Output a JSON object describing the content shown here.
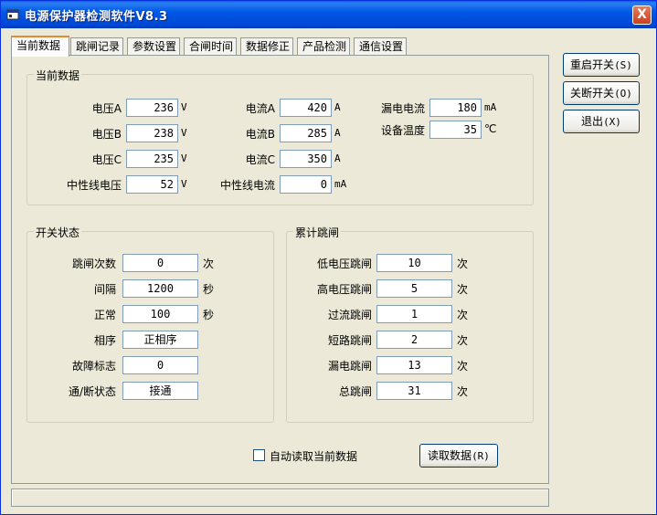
{
  "window": {
    "title": "电源保护器检测软件V8.3",
    "close_label": "X"
  },
  "tabs": [
    "当前数据",
    "跳闸记录",
    "参数设置",
    "合闸时间",
    "数据修正",
    "产品检测",
    "通信设置"
  ],
  "current": {
    "group_title": "当前数据",
    "voltage_a": {
      "label": "电压A",
      "value": "236",
      "unit": "V"
    },
    "voltage_b": {
      "label": "电压B",
      "value": "238",
      "unit": "V"
    },
    "voltage_c": {
      "label": "电压C",
      "value": "235",
      "unit": "V"
    },
    "neutral_voltage": {
      "label": "中性线电压",
      "value": "52",
      "unit": "V"
    },
    "current_a": {
      "label": "电流A",
      "value": "420",
      "unit": "A"
    },
    "current_b": {
      "label": "电流B",
      "value": "285",
      "unit": "A"
    },
    "current_c": {
      "label": "电流C",
      "value": "350",
      "unit": "A"
    },
    "neutral_current": {
      "label": "中性线电流",
      "value": "0",
      "unit": "mA"
    },
    "leakage": {
      "label": "漏电电流",
      "value": "180",
      "unit": "mA"
    },
    "temperature": {
      "label": "设备温度",
      "value": "35",
      "unit": "℃"
    }
  },
  "switch": {
    "group_title": "开关状态",
    "trip_count": {
      "label": "跳闸次数",
      "value": "0",
      "unit": "次"
    },
    "interval": {
      "label": "间隔",
      "value": "1200",
      "unit": "秒"
    },
    "normal": {
      "label": "正常",
      "value": "100",
      "unit": "秒"
    },
    "phase": {
      "label": "相序",
      "value": "正相序"
    },
    "fault": {
      "label": "故障标志",
      "value": "0"
    },
    "onoff": {
      "label": "通/断状态",
      "value": "接通"
    }
  },
  "trips": {
    "group_title": "累计跳闸",
    "low_voltage": {
      "label": "低电压跳闸",
      "value": "10",
      "unit": "次"
    },
    "high_voltage": {
      "label": "高电压跳闸",
      "value": "5",
      "unit": "次"
    },
    "overcurrent": {
      "label": "过流跳闸",
      "value": "1",
      "unit": "次"
    },
    "short_circuit": {
      "label": "短路跳闸",
      "value": "2",
      "unit": "次"
    },
    "leakage": {
      "label": "漏电跳闸",
      "value": "13",
      "unit": "次"
    },
    "total": {
      "label": "总跳闸",
      "value": "31",
      "unit": "次"
    }
  },
  "auto_read": {
    "label": "自动读取当前数据",
    "checked": false
  },
  "buttons": {
    "read": {
      "label": "读取数据",
      "hotkey": "(R)"
    },
    "restart": {
      "label": "重启开关",
      "hotkey": "(S)"
    },
    "shutdown": {
      "label": "关断开关",
      "hotkey": "(O)"
    },
    "exit": {
      "label": "退出",
      "hotkey": "(X)"
    }
  },
  "status_text": ""
}
